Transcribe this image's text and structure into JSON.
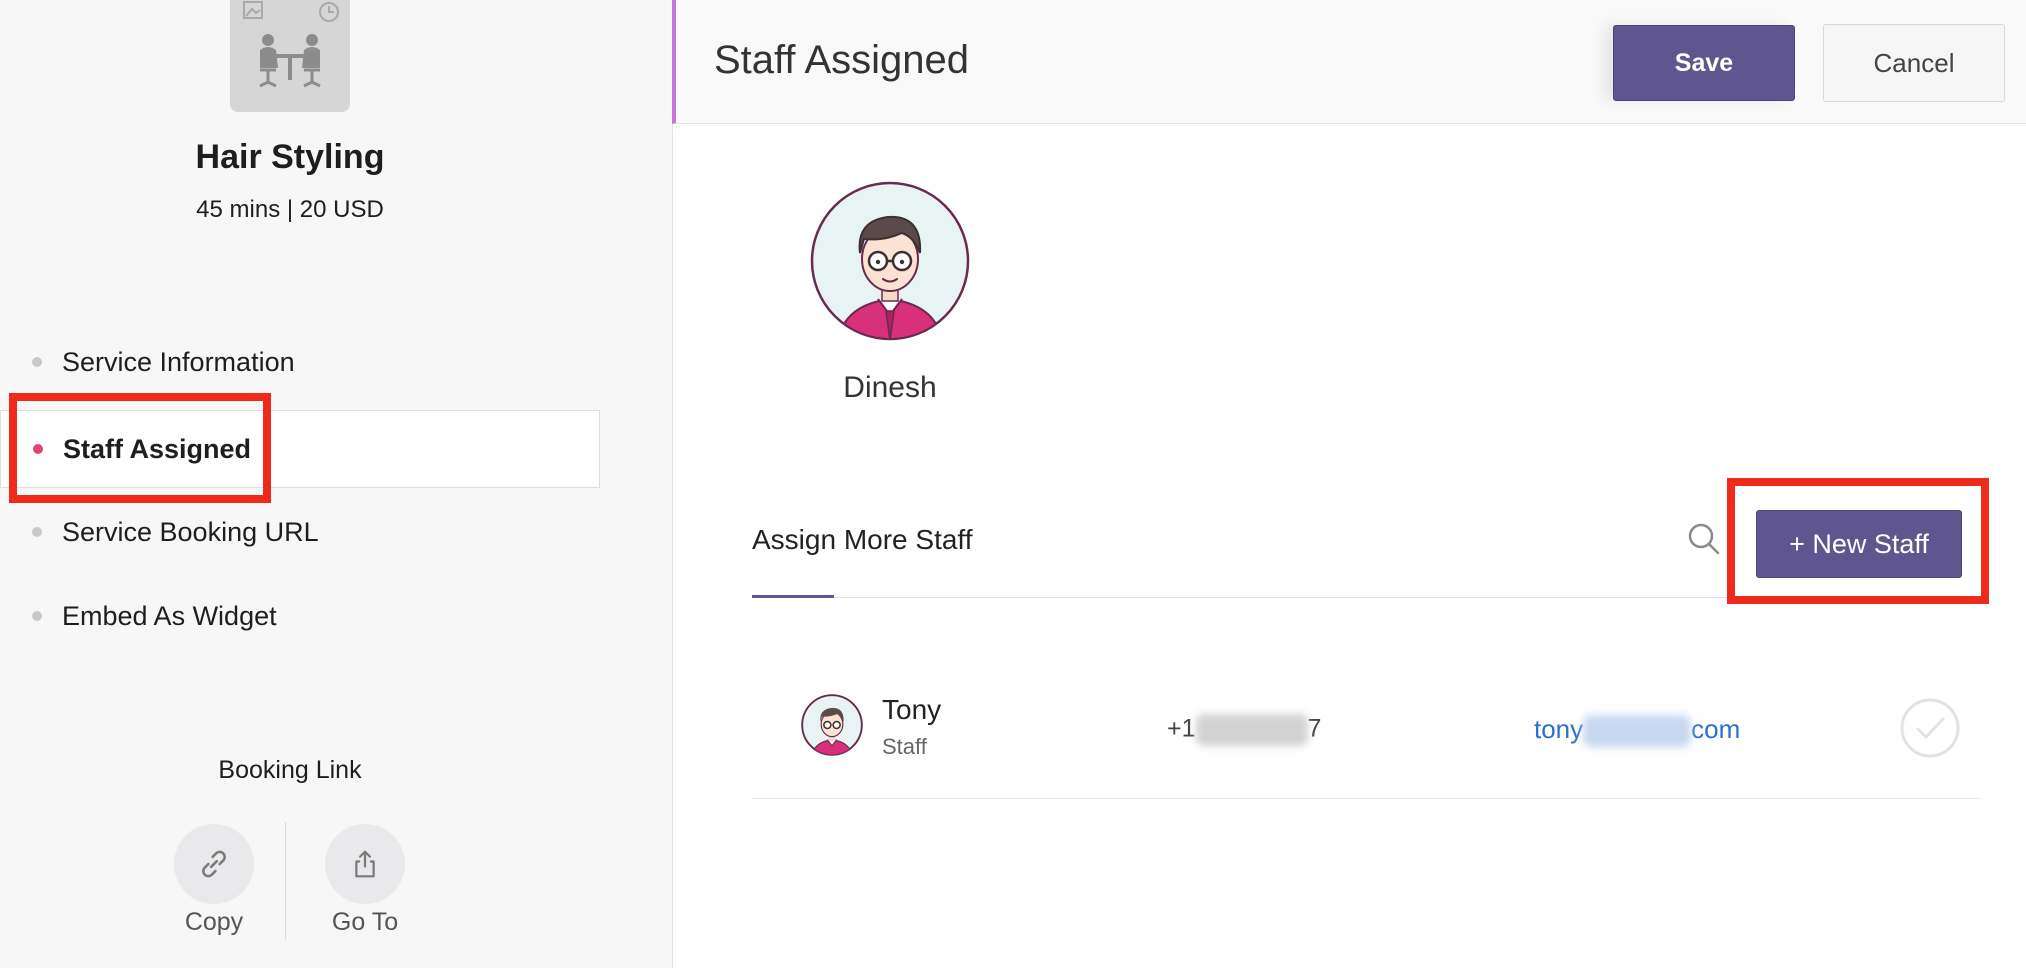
{
  "sidebar": {
    "service_name": "Hair Styling",
    "service_meta": "45 mins | 20 USD",
    "nav": [
      {
        "label": "Service Information"
      },
      {
        "label": "Staff Assigned"
      },
      {
        "label": "Service Booking URL"
      },
      {
        "label": "Embed As Widget"
      }
    ],
    "booking_link": {
      "title": "Booking Link",
      "copy_label": "Copy",
      "goto_label": "Go To"
    }
  },
  "header": {
    "title": "Staff Assigned",
    "save_label": "Save",
    "cancel_label": "Cancel"
  },
  "assigned_staff": {
    "name": "Dinesh"
  },
  "assign_more": {
    "title": "Assign More Staff",
    "new_staff_label": "+ New Staff",
    "rows": [
      {
        "name": "Tony",
        "role": "Staff",
        "phone_prefix": "+1",
        "phone_suffix": "7",
        "email_prefix": "tony",
        "email_suffix": "com"
      }
    ]
  },
  "colors": {
    "primary": "#5f5690",
    "active_dot": "#e3456f",
    "highlight": "#ee2a1b",
    "link": "#2b6fd0",
    "header_accent": "#c974d8"
  }
}
